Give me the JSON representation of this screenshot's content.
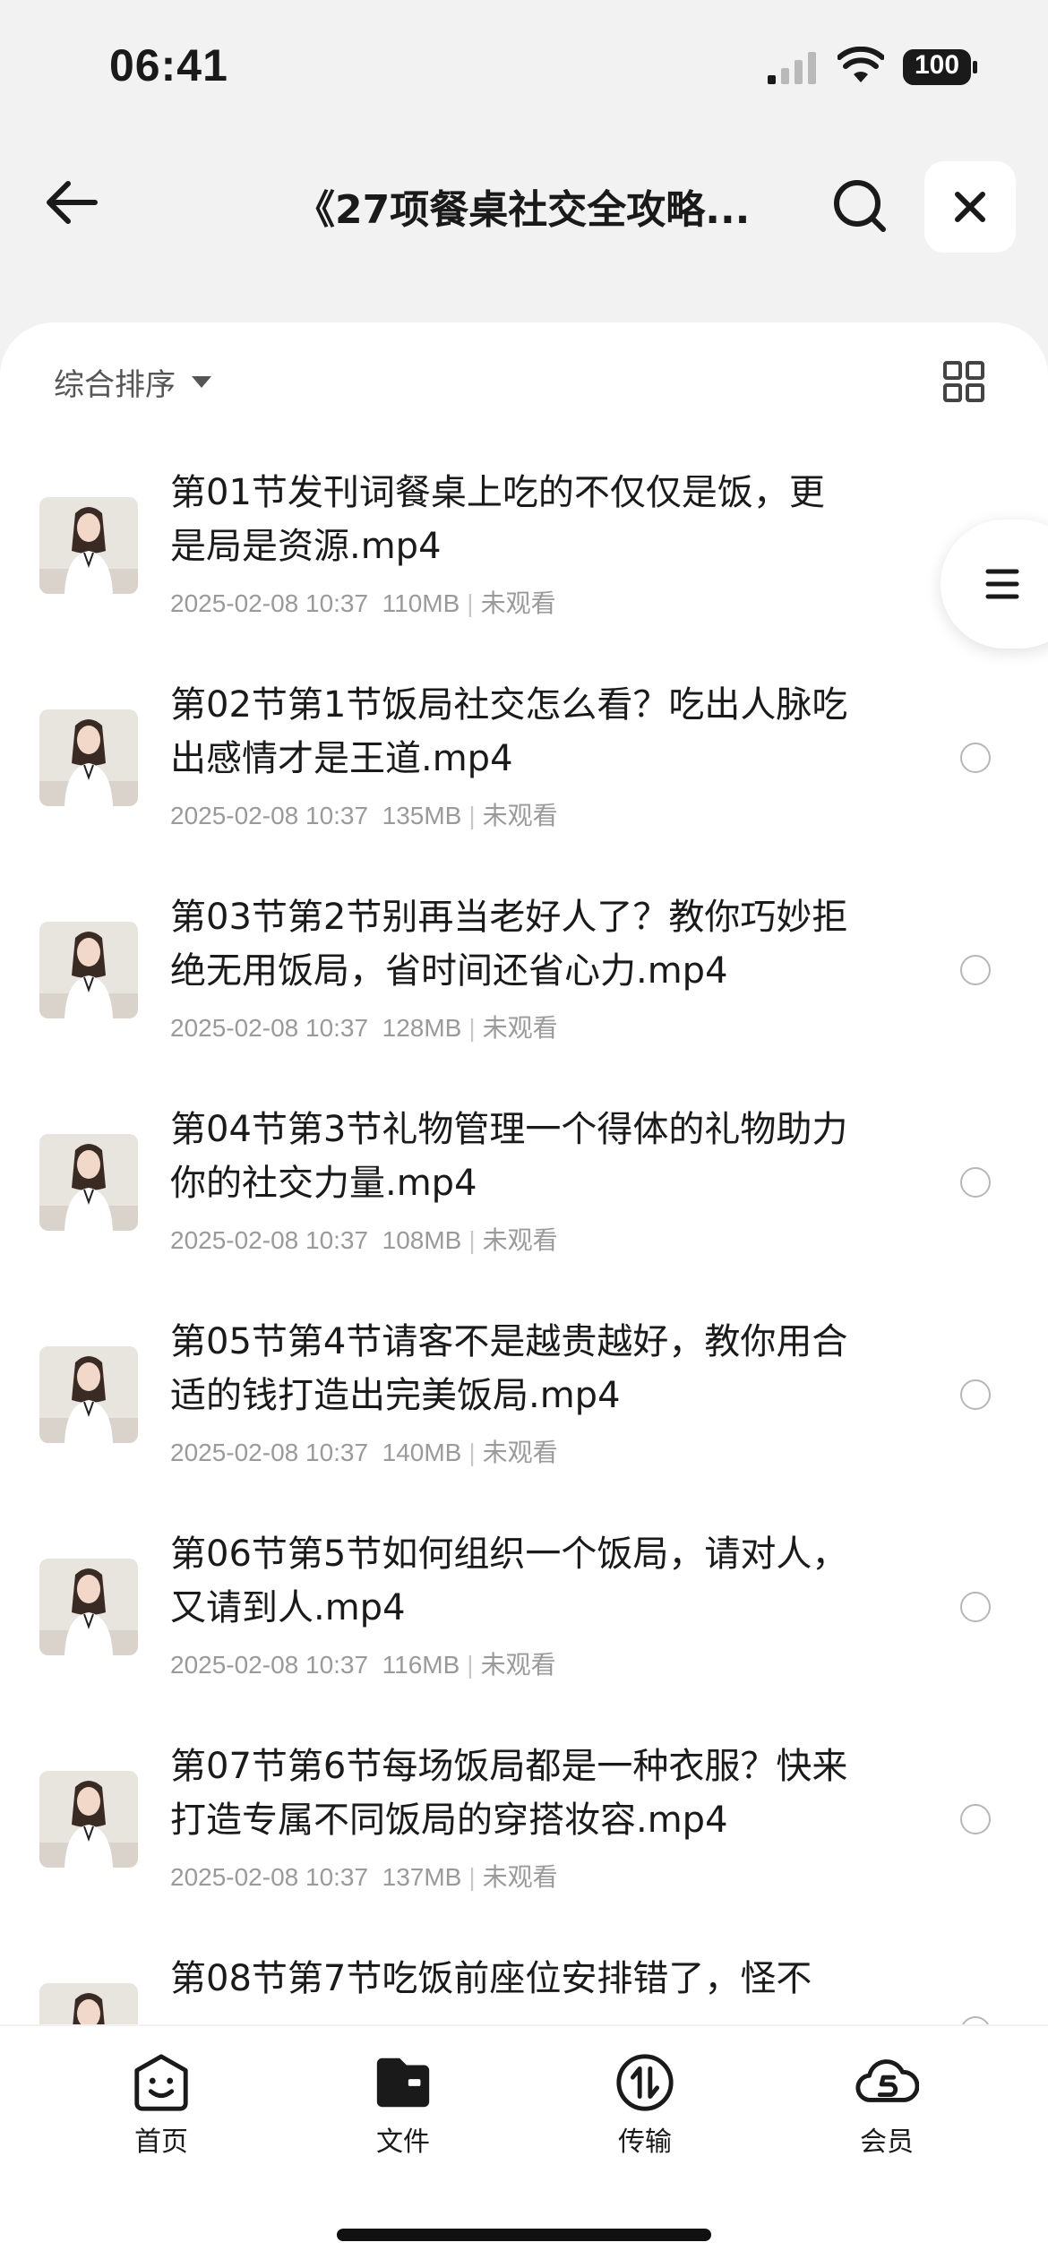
{
  "status": {
    "time": "06:41",
    "battery": "100"
  },
  "nav": {
    "title": "《27项餐桌社交全攻略..."
  },
  "toolbar": {
    "sort_label": "综合排序"
  },
  "files": [
    {
      "title": "第01节发刊词餐桌上吃的不仅仅是饭，更是局是资源.mp4",
      "date": "2025-02-08 10:37",
      "size": "110MB",
      "status": "未观看"
    },
    {
      "title": "第02节第1节饭局社交怎么看？吃出人脉吃出感情才是王道.mp4",
      "date": "2025-02-08 10:37",
      "size": "135MB",
      "status": "未观看"
    },
    {
      "title": "第03节第2节别再当老好人了？教你巧妙拒绝无用饭局，省时间还省心力.mp4",
      "date": "2025-02-08 10:37",
      "size": "128MB",
      "status": "未观看"
    },
    {
      "title": "第04节第3节礼物管理一个得体的礼物助力你的社交力量.mp4",
      "date": "2025-02-08 10:37",
      "size": "108MB",
      "status": "未观看"
    },
    {
      "title": "第05节第4节请客不是越贵越好，教你用合适的钱打造出完美饭局.mp4",
      "date": "2025-02-08 10:37",
      "size": "140MB",
      "status": "未观看"
    },
    {
      "title": "第06节第5节如何组织一个饭局，请对人，又请到人.mp4",
      "date": "2025-02-08 10:37",
      "size": "116MB",
      "status": "未观看"
    },
    {
      "title": "第07节第6节每场饭局都是一种衣服？快来打造专属不同饭局的穿搭妆容.mp4",
      "date": "2025-02-08 10:37",
      "size": "137MB",
      "status": "未观看"
    },
    {
      "title": "第08节第7节吃饭前座位安排错了，怪不",
      "date": "",
      "size": "",
      "status": ""
    }
  ],
  "tabs": [
    {
      "label": "首页",
      "icon": "home-face-icon"
    },
    {
      "label": "文件",
      "icon": "folder-icon"
    },
    {
      "label": "传输",
      "icon": "transfer-icon"
    },
    {
      "label": "会员",
      "icon": "vip-cloud-icon"
    }
  ]
}
